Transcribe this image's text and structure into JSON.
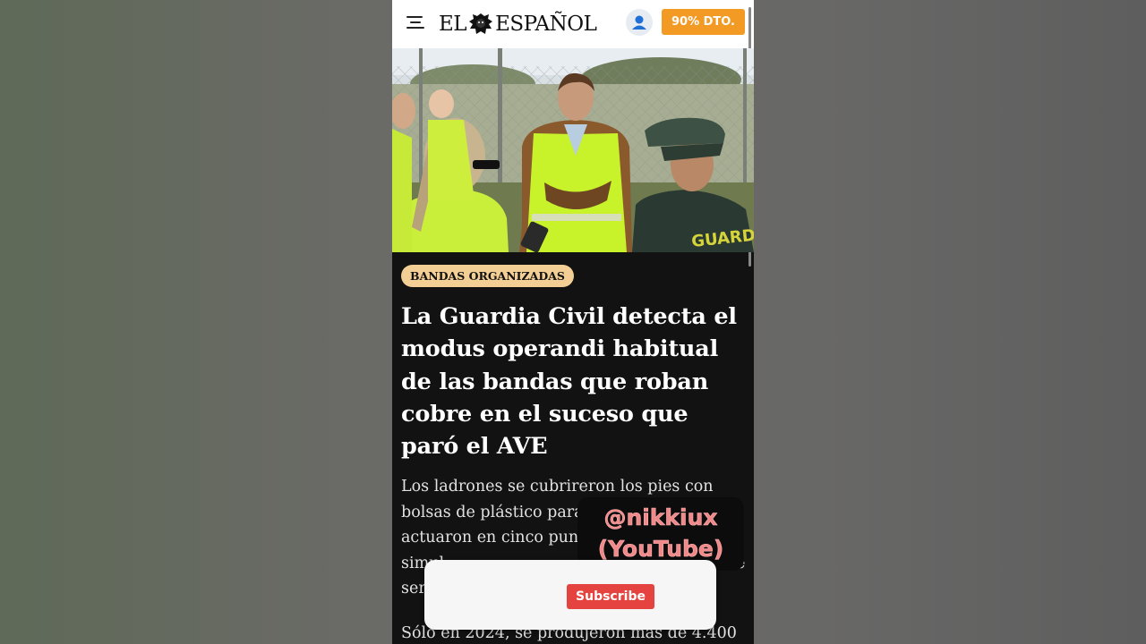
{
  "header": {
    "logo_left": "EL",
    "logo_right": "ESPAÑOL",
    "promo_label": "90% DTO."
  },
  "article": {
    "tag": "BANDAS ORGANIZADAS",
    "headline": "La Guardia Civil detecta el modus operandi habitual de las bandas que roban cobre en el suceso que paró el AVE",
    "lede_lines": [
      "Los ladrones se cubrireron los pies con",
      "bolsas de plástico para r",
      "actuaron en cinco punt",
      "simul",
      "ser"
    ],
    "lede_tail": "e",
    "next_paragraph": "Sólo en 2024, se produjeron más de 4.400"
  },
  "hero_image": {
    "vest_text": "GUARDIA"
  },
  "overlay": {
    "watermark_line1": "@nikkiux",
    "watermark_line2": "(YouTube)",
    "subscribe_label": "Subscribe"
  },
  "colors": {
    "promo": "#f39a24",
    "tag_bg": "#f3cf95",
    "page_bg": "#121212",
    "subscribe": "#e5433f"
  },
  "icons": [
    "menu-icon",
    "lion-logo-icon",
    "user-icon"
  ]
}
